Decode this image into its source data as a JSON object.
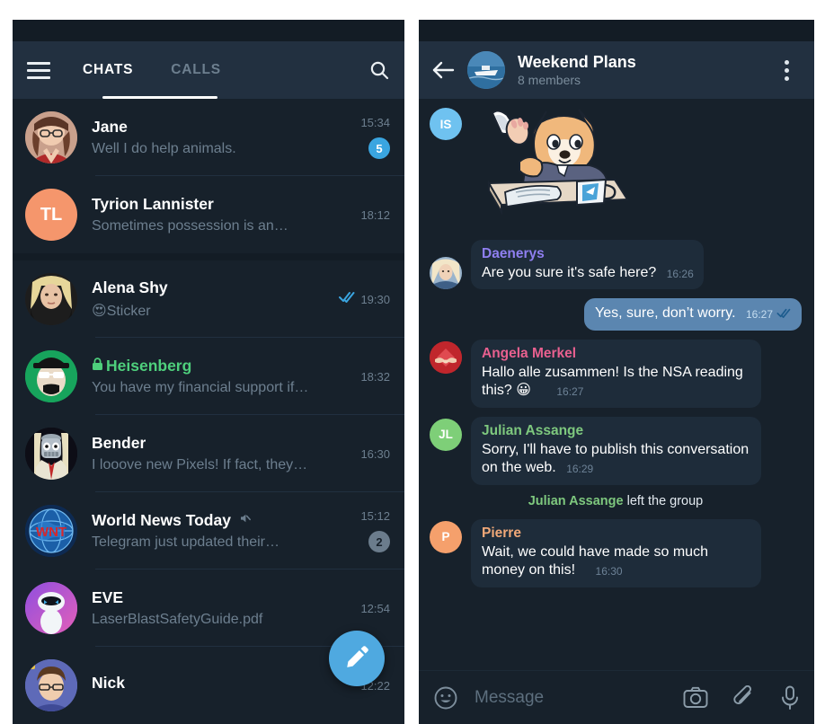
{
  "app": {
    "name": "Telegram",
    "theme": "dark"
  },
  "colors": {
    "panel_bg": "#17212b",
    "header_bg": "#223040",
    "accent_blue": "#4fa9e0",
    "badge_blue": "#3aa5e0",
    "badge_muted": "#6b7c8c",
    "secret_green": "#4ecf7c",
    "outgoing_bubble": "#5b86b0",
    "incoming_bubble": "#1e2c3a",
    "secondary_text": "#6d7f8f"
  },
  "chat_list": {
    "menu_icon": "hamburger-menu-icon",
    "search_icon": "search-icon",
    "tabs": [
      {
        "label": "CHATS",
        "active": true
      },
      {
        "label": "CALLS",
        "active": false
      }
    ],
    "fab_icon": "pencil-compose-icon",
    "items": [
      {
        "name": "Jane",
        "preview": "Well I do help animals.",
        "time": "15:34",
        "badge": "5",
        "badge_type": "blue",
        "avatar_type": "photo",
        "avatar_kind": "woman-glasses",
        "secret": false,
        "muted": false,
        "checks": false
      },
      {
        "name": "Tyrion Lannister",
        "preview": "Sometimes possession is an…",
        "time": "18:12",
        "badge": "",
        "badge_type": "none",
        "avatar_type": "initials",
        "initials": "TL",
        "avatar_color": "#f5966c",
        "secret": false,
        "muted": false,
        "checks": false
      },
      {
        "name": "Alena Shy",
        "preview": "Sticker",
        "preview_emoji": "😍",
        "time": "19:30",
        "badge": "",
        "badge_type": "none",
        "avatar_type": "photo",
        "avatar_kind": "blonde-woman",
        "secret": false,
        "muted": false,
        "checks": true
      },
      {
        "name": "Heisenberg",
        "preview": "You have my financial support if…",
        "time": "18:32",
        "badge": "",
        "badge_type": "none",
        "avatar_type": "photo",
        "avatar_kind": "heisenberg",
        "secret": true,
        "muted": false,
        "checks": false
      },
      {
        "name": "Bender",
        "preview": "I looove new Pixels! If fact, they…",
        "time": "16:30",
        "badge": "",
        "badge_type": "none",
        "avatar_type": "photo",
        "avatar_kind": "bender",
        "secret": false,
        "muted": false,
        "checks": false
      },
      {
        "name": "World News Today",
        "preview": "Telegram just updated their…",
        "time": "15:12",
        "badge": "2",
        "badge_type": "grey",
        "avatar_type": "photo",
        "avatar_kind": "wnt-globe",
        "secret": false,
        "muted": true,
        "checks": false
      },
      {
        "name": "EVE",
        "preview": "LaserBlastSafetyGuide.pdf",
        "time": "12:54",
        "badge": "",
        "badge_type": "none",
        "avatar_type": "photo",
        "avatar_kind": "eve-robot",
        "secret": false,
        "muted": false,
        "checks": false
      },
      {
        "name": "Nick",
        "preview": "",
        "time": "12:22",
        "badge": "",
        "badge_type": "none",
        "avatar_type": "photo",
        "avatar_kind": "nick",
        "secret": false,
        "muted": false,
        "checks": false
      }
    ]
  },
  "conversation": {
    "back_icon": "back-arrow-icon",
    "menu_icon": "more-vertical-icon",
    "title": "Weekend Plans",
    "subtitle": "8 members",
    "avatar_kind": "boat-photo",
    "messages": [
      {
        "kind": "sticker",
        "avatar_initials": "IS",
        "avatar_color": "#6fc2f0",
        "sticker_name": "shiba-dog-reading-newspaper"
      },
      {
        "kind": "in",
        "sender": "Daenerys",
        "sender_color": "#8f7ff0",
        "text": "Are you sure it's safe here?",
        "time": "16:26",
        "avatar_type": "photo",
        "avatar_kind": "daenerys"
      },
      {
        "kind": "out",
        "sender": "",
        "text": "Yes, sure, don’t worry.",
        "time": "16:27",
        "checks": true
      },
      {
        "kind": "in",
        "sender": "Angela Merkel",
        "sender_color": "#e8608f",
        "text": "Hallo alle zusammen! Is the NSA reading this? 😀",
        "time": "16:27",
        "avatar_type": "photo",
        "avatar_kind": "merkel"
      },
      {
        "kind": "in",
        "sender": "Julian Assange",
        "sender_color": "#7ec87e",
        "text": "Sorry, I'll have to publish this conversation on the web.",
        "time": "16:29",
        "avatar_type": "initials",
        "avatar_initials": "JL",
        "avatar_color": "#7ecf78"
      },
      {
        "kind": "system",
        "actor": "Julian Assange",
        "actor_color": "#7ec87e",
        "text": " left the group"
      },
      {
        "kind": "in",
        "sender": "Pierre",
        "sender_color": "#f0a878",
        "text": "Wait, we could have made so much money on this!",
        "time": "16:30",
        "avatar_type": "initials",
        "avatar_initials": "P",
        "avatar_color": "#f5a06c"
      }
    ],
    "composer": {
      "emoji_icon": "smiley-face-icon",
      "placeholder": "Message",
      "camera_icon": "camera-icon",
      "attach_icon": "paperclip-icon",
      "mic_icon": "microphone-icon"
    }
  }
}
